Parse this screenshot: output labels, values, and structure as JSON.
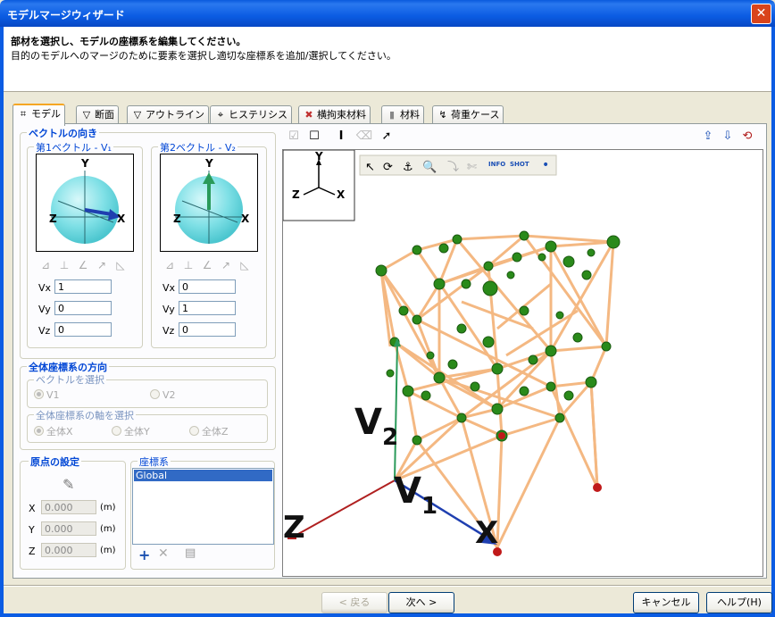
{
  "window": {
    "title": "モデルマージウィザード",
    "close": "✕"
  },
  "header": {
    "title": "部材を選択し、モデルの座標系を編集してください。",
    "desc": "目的のモデルへのマージのために要素を選択し適切な座標系を追加/選択してください。"
  },
  "tabs": [
    {
      "label": "モデル",
      "icon": "⌗",
      "active": true
    },
    {
      "label": "断面",
      "icon": "▽"
    },
    {
      "label": "アウトライン",
      "icon": "▽"
    },
    {
      "label": "ヒステリシス",
      "icon": "⌖"
    },
    {
      "label": "横拘束材料",
      "icon": "✖"
    },
    {
      "label": "材料",
      "icon": "▮"
    },
    {
      "label": "荷重ケース",
      "icon": "↯"
    }
  ],
  "vector_group": {
    "title": "ベクトルの向き",
    "v1": {
      "label": "第1ベクトル - V₁",
      "vx_label": "Vx",
      "vy_label": "Vy",
      "vz_label": "Vz",
      "vx": "1",
      "vy": "0",
      "vz": "0"
    },
    "v2": {
      "label": "第2ベクトル - V₂",
      "vx_label": "Vx",
      "vy_label": "Vy",
      "vz_label": "Vz",
      "vx": "0",
      "vy": "1",
      "vz": "0"
    },
    "axis_labels": {
      "x": "X",
      "y": "Y",
      "z": "Z"
    }
  },
  "global_group": {
    "title": "全体座標系の方向",
    "select_vector": "ベクトルを選択",
    "v1": "V1",
    "v2": "V2",
    "select_axis": "全体座標系の軸を選択",
    "ax": "全体X",
    "ay": "全体Y",
    "az": "全体Z"
  },
  "origin_group": {
    "title": "原点の設定",
    "x_label": "X",
    "y_label": "Y",
    "z_label": "Z",
    "x": "0.000",
    "y": "0.000",
    "z": "0.000",
    "unit": "(m)"
  },
  "coord_group": {
    "title": "座標系",
    "items": [
      "Global"
    ]
  },
  "viewer": {
    "triad": {
      "x": "X",
      "y": "Y",
      "z": "Z"
    },
    "labels": {
      "v1": "V1",
      "v2": "V2",
      "x": "X",
      "z": "Z"
    }
  },
  "buttons": {
    "back": "< 戻る",
    "next": "次へ >",
    "cancel": "キャンセル",
    "help": "ヘルプ(H)"
  },
  "colors": {
    "member": "#f4b882",
    "node": "#2a8a1a",
    "v1": "#1f3fb0",
    "v2": "#2a9a5a",
    "sphere": "#7fe0e6"
  }
}
